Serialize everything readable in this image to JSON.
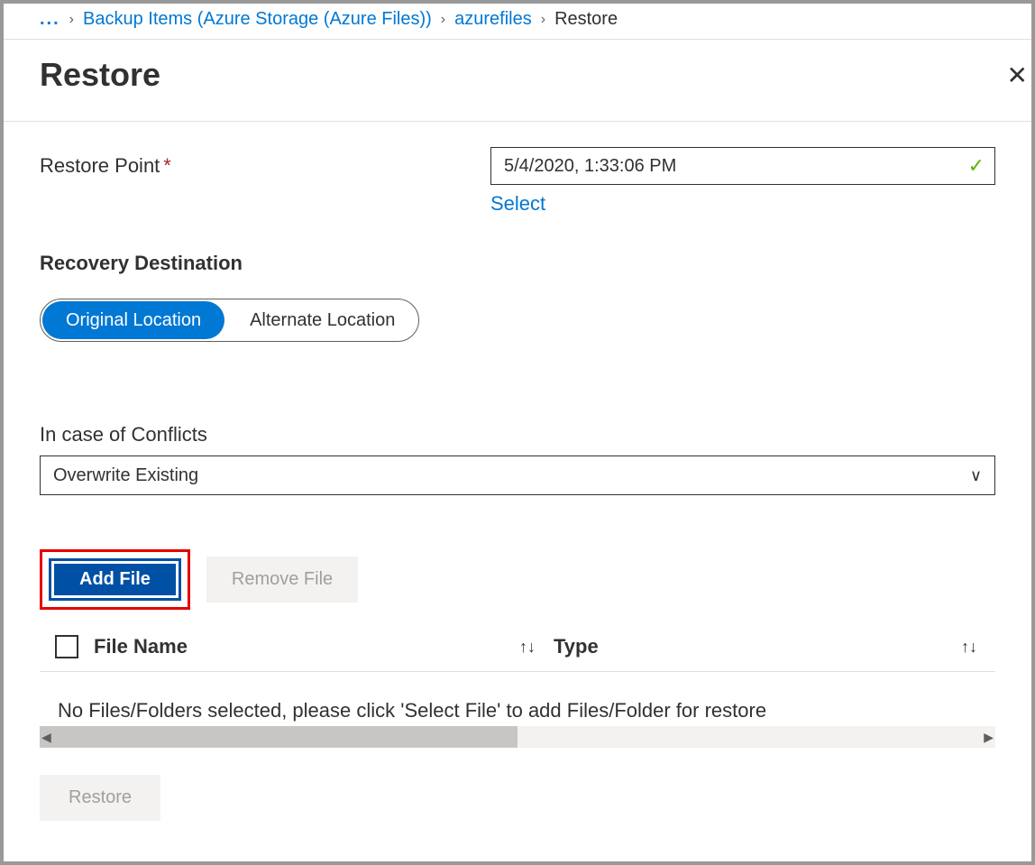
{
  "breadcrumb": {
    "ellipsis": "...",
    "item1": "Backup Items (Azure Storage (Azure Files))",
    "item2": "azurefiles",
    "current": "Restore"
  },
  "header": {
    "title": "Restore"
  },
  "form": {
    "restore_point_label": "Restore Point",
    "restore_point_value": "5/4/2020, 1:33:06 PM",
    "select_link": "Select",
    "recovery_dest_label": "Recovery Destination",
    "location_original": "Original Location",
    "location_alternate": "Alternate Location",
    "conflicts_label": "In case of Conflicts",
    "conflicts_value": "Overwrite Existing"
  },
  "buttons": {
    "add_file": "Add File",
    "remove_file": "Remove File",
    "restore": "Restore"
  },
  "table": {
    "col_name": "File Name",
    "col_type": "Type",
    "empty": "No Files/Folders selected, please click 'Select File' to add Files/Folder for restore"
  }
}
